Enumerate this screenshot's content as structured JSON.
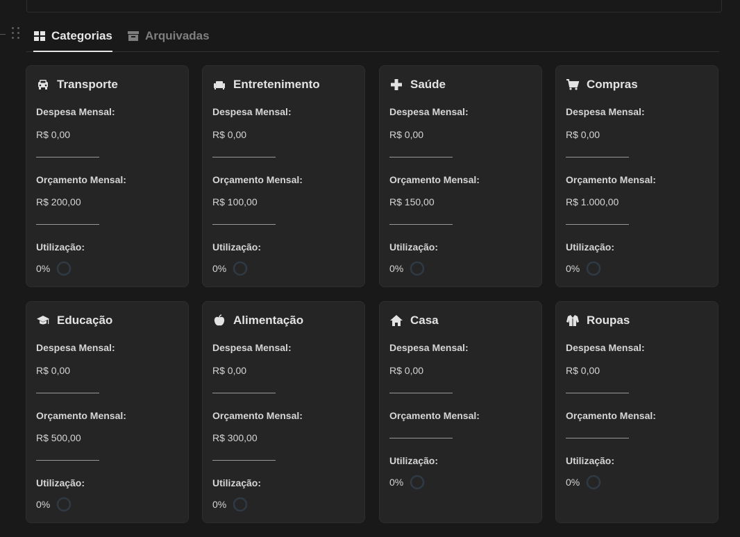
{
  "tabs": [
    {
      "label": "Categorias",
      "icon": "grid-icon",
      "active": true
    },
    {
      "label": "Arquivadas",
      "icon": "archive-icon",
      "active": false
    }
  ],
  "labels": {
    "expense": "Despesa Mensal:",
    "budget": "Orçamento Mensal:",
    "usage": "Utilização:"
  },
  "colors": {
    "background": "#191919",
    "card": "#252525",
    "ring": "#2f3a44",
    "text": "#d6d6d6"
  },
  "categories": [
    {
      "name": "Transporte",
      "icon": "car-icon",
      "expense": "R$ 0,00",
      "budget": "R$ 200,00",
      "usage": "0%"
    },
    {
      "name": "Entretenimento",
      "icon": "sofa-icon",
      "expense": "R$ 0,00",
      "budget": "R$ 100,00",
      "usage": "0%"
    },
    {
      "name": "Saúde",
      "icon": "plus-icon",
      "expense": "R$ 0,00",
      "budget": "R$ 150,00",
      "usage": "0%"
    },
    {
      "name": "Compras",
      "icon": "cart-icon",
      "expense": "R$ 0,00",
      "budget": "R$ 1.000,00",
      "usage": "0%"
    },
    {
      "name": "Educação",
      "icon": "graduation-cap-icon",
      "expense": "R$ 0,00",
      "budget": "R$ 500,00",
      "usage": "0%"
    },
    {
      "name": "Alimentação",
      "icon": "apple-icon",
      "expense": "R$ 0,00",
      "budget": "R$ 300,00",
      "usage": "0%"
    },
    {
      "name": "Casa",
      "icon": "house-icon",
      "expense": "R$ 0,00",
      "budget": "",
      "usage": "0%"
    },
    {
      "name": "Roupas",
      "icon": "coat-icon",
      "expense": "R$ 0,00",
      "budget": "",
      "usage": "0%"
    }
  ]
}
